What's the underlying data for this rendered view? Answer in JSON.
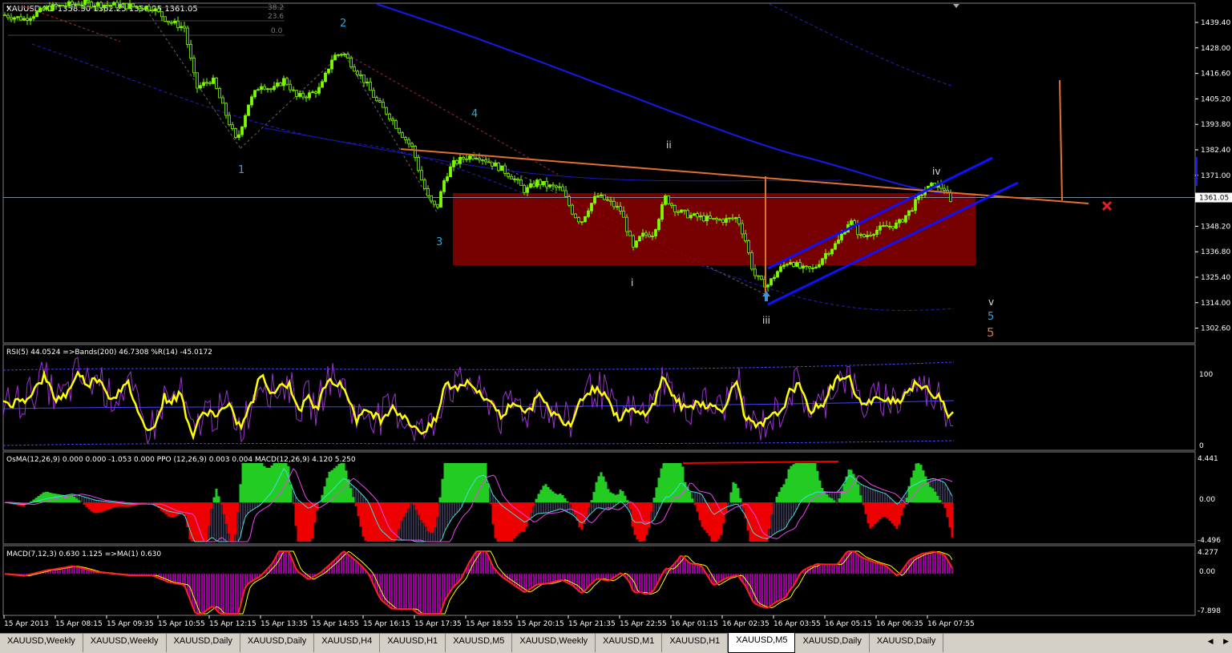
{
  "chart_data": {
    "type": "candlestick",
    "symbol_header": "XAUUSD,M5  1358.30 1362.25 1358.25 1361.05",
    "ylim": [
      1296.0,
      1448.0
    ],
    "y_ticks": [
      "1439.40",
      "1428.00",
      "1416.60",
      "1405.20",
      "1393.80",
      "1382.40",
      "1371.00",
      "1348.20",
      "1336.80",
      "1325.40",
      "1314.00",
      "1302.60"
    ],
    "current_price_label": "1361.05",
    "current_price": 1361.05,
    "x_ticks": [
      "15 Apr 2013",
      "15 Apr 08:15",
      "15 Apr 09:35",
      "15 Apr 10:55",
      "15 Apr 12:15",
      "15 Apr 13:35",
      "15 Apr 14:55",
      "15 Apr 16:15",
      "15 Apr 17:35",
      "15 Apr 18:55",
      "15 Apr 20:15",
      "15 Apr 21:35",
      "15 Apr 22:55",
      "16 Apr 01:15",
      "16 Apr 02:35",
      "16 Apr 03:55",
      "16 Apr 05:15",
      "16 Apr 06:35",
      "16 Apr 07:55"
    ],
    "fib_labels": [
      "38.2",
      "23.6",
      "0.0"
    ],
    "close_path": [
      [
        0,
        1443
      ],
      [
        30,
        1441
      ],
      [
        60,
        1446
      ],
      [
        100,
        1448
      ],
      [
        150,
        1447
      ],
      [
        190,
        1446
      ],
      [
        210,
        1440
      ],
      [
        230,
        1437
      ],
      [
        245,
        1410
      ],
      [
        265,
        1414
      ],
      [
        280,
        1400
      ],
      [
        295,
        1386
      ],
      [
        310,
        1403
      ],
      [
        325,
        1412
      ],
      [
        340,
        1409
      ],
      [
        355,
        1414
      ],
      [
        370,
        1406
      ],
      [
        385,
        1407
      ],
      [
        400,
        1410
      ],
      [
        415,
        1424
      ],
      [
        428,
        1426
      ],
      [
        440,
        1420
      ],
      [
        455,
        1413
      ],
      [
        470,
        1404
      ],
      [
        485,
        1398
      ],
      [
        500,
        1390
      ],
      [
        515,
        1383
      ],
      [
        525,
        1370
      ],
      [
        535,
        1360
      ],
      [
        545,
        1356
      ],
      [
        555,
        1370
      ],
      [
        565,
        1376
      ],
      [
        580,
        1379
      ],
      [
        595,
        1380
      ],
      [
        610,
        1377
      ],
      [
        625,
        1374
      ],
      [
        640,
        1370
      ],
      [
        655,
        1364
      ],
      [
        670,
        1368
      ],
      [
        685,
        1366
      ],
      [
        700,
        1365
      ],
      [
        715,
        1354
      ],
      [
        725,
        1350
      ],
      [
        735,
        1357
      ],
      [
        745,
        1362
      ],
      [
        760,
        1359
      ],
      [
        775,
        1355
      ],
      [
        790,
        1338
      ],
      [
        800,
        1344
      ],
      [
        815,
        1345
      ],
      [
        830,
        1361
      ],
      [
        845,
        1355
      ],
      [
        860,
        1353
      ],
      [
        875,
        1352
      ],
      [
        890,
        1351
      ],
      [
        905,
        1351
      ],
      [
        920,
        1352
      ],
      [
        930,
        1342
      ],
      [
        940,
        1327
      ],
      [
        950,
        1323
      ],
      [
        958,
        1322
      ],
      [
        970,
        1328
      ],
      [
        985,
        1333
      ],
      [
        1000,
        1329
      ],
      [
        1015,
        1329
      ],
      [
        1030,
        1336
      ],
      [
        1045,
        1341
      ],
      [
        1060,
        1351
      ],
      [
        1075,
        1343
      ],
      [
        1090,
        1346
      ],
      [
        1105,
        1348
      ],
      [
        1120,
        1349
      ],
      [
        1135,
        1355
      ],
      [
        1150,
        1363
      ],
      [
        1165,
        1367
      ],
      [
        1178,
        1365
      ],
      [
        1188,
        1357
      ]
    ],
    "wave_labels": [
      {
        "text": "1",
        "price": 1384
      },
      {
        "text": "2",
        "price": 1443
      },
      {
        "text": "3",
        "price": 1343
      },
      {
        "text": "4",
        "price": 1398
      },
      {
        "text": "ii",
        "price": 1381
      },
      {
        "text": "i",
        "price": 1328
      },
      {
        "text": "iii",
        "price": 1306
      },
      {
        "text": "iv",
        "price": 1374
      },
      {
        "text": "v",
        "price": 1318
      },
      {
        "text": "5",
        "price": 1313
      },
      {
        "text": "5",
        "price": 1305
      }
    ],
    "rsi": {
      "header": "RSI(5) 44.0524  =>Bands(200) 46.7308  %R(14) -45.0172",
      "ylim": [
        0,
        100
      ],
      "y_ticks": [
        "100",
        "0"
      ],
      "path": [
        [
          0,
          50
        ],
        [
          15,
          48
        ],
        [
          30,
          52
        ],
        [
          45,
          65
        ],
        [
          55,
          78
        ],
        [
          70,
          52
        ],
        [
          85,
          60
        ],
        [
          95,
          82
        ],
        [
          110,
          70
        ],
        [
          125,
          78
        ],
        [
          135,
          55
        ],
        [
          150,
          60
        ],
        [
          160,
          70
        ],
        [
          170,
          45
        ],
        [
          180,
          20
        ],
        [
          195,
          25
        ],
        [
          205,
          55
        ],
        [
          215,
          50
        ],
        [
          225,
          60
        ],
        [
          240,
          10
        ],
        [
          255,
          40
        ],
        [
          270,
          35
        ],
        [
          285,
          45
        ],
        [
          300,
          20
        ],
        [
          315,
          50
        ],
        [
          325,
          80
        ],
        [
          340,
          60
        ],
        [
          350,
          68
        ],
        [
          360,
          70
        ],
        [
          375,
          40
        ],
        [
          385,
          55
        ],
        [
          395,
          40
        ],
        [
          410,
          80
        ],
        [
          420,
          70
        ],
        [
          430,
          65
        ],
        [
          445,
          30
        ],
        [
          460,
          40
        ],
        [
          475,
          30
        ],
        [
          490,
          45
        ],
        [
          505,
          30
        ],
        [
          520,
          20
        ],
        [
          530,
          15
        ],
        [
          545,
          30
        ],
        [
          555,
          70
        ],
        [
          570,
          65
        ],
        [
          585,
          75
        ],
        [
          600,
          55
        ],
        [
          615,
          50
        ],
        [
          625,
          30
        ],
        [
          635,
          45
        ],
        [
          645,
          50
        ],
        [
          660,
          35
        ],
        [
          670,
          60
        ],
        [
          685,
          40
        ],
        [
          700,
          30
        ],
        [
          712,
          25
        ],
        [
          725,
          55
        ],
        [
          740,
          65
        ],
        [
          755,
          60
        ],
        [
          770,
          30
        ],
        [
          785,
          40
        ],
        [
          800,
          35
        ],
        [
          815,
          45
        ],
        [
          828,
          80
        ],
        [
          840,
          55
        ],
        [
          855,
          40
        ],
        [
          870,
          50
        ],
        [
          885,
          45
        ],
        [
          900,
          40
        ],
        [
          912,
          60
        ],
        [
          920,
          75
        ],
        [
          930,
          30
        ],
        [
          945,
          20
        ],
        [
          960,
          30
        ],
        [
          975,
          40
        ],
        [
          985,
          60
        ],
        [
          995,
          70
        ],
        [
          1010,
          40
        ],
        [
          1025,
          45
        ],
        [
          1040,
          70
        ],
        [
          1050,
          80
        ],
        [
          1060,
          75
        ],
        [
          1075,
          45
        ],
        [
          1090,
          50
        ],
        [
          1105,
          55
        ],
        [
          1120,
          50
        ],
        [
          1135,
          65
        ],
        [
          1145,
          70
        ],
        [
          1160,
          60
        ],
        [
          1175,
          55
        ],
        [
          1185,
          30
        ],
        [
          1190,
          45
        ]
      ]
    },
    "osma": {
      "header": "OsMA(12,26,9) 0.000 0.000 -1.053 0.000  PPO (12,26,9) 0.003 0.004  MACD(12,26,9) 4.120 5.250",
      "ylim": [
        -5.2,
        5.2
      ],
      "y_ticks": [
        "4.441",
        "0.00",
        "-4.496"
      ]
    },
    "macd2": {
      "header": "MACD(7,12,3) 0.630 1.125  =>MA(1) 0.630",
      "ylim": [
        -8.5,
        4.8
      ],
      "y_ticks": [
        "4.277",
        "0.00",
        "-7.898"
      ]
    }
  },
  "tabs": [
    {
      "label": "XAUUSD,Weekly",
      "active": false
    },
    {
      "label": "XAUUSD,Weekly",
      "active": false
    },
    {
      "label": "XAUUSD,Daily",
      "active": false
    },
    {
      "label": "XAUUSD,Daily",
      "active": false
    },
    {
      "label": "XAUUSD,H4",
      "active": false
    },
    {
      "label": "XAUUSD,H1",
      "active": false
    },
    {
      "label": "XAUUSD,M5",
      "active": false
    },
    {
      "label": "XAUUSD,Weekly",
      "active": false
    },
    {
      "label": "XAUUSD,M1",
      "active": false
    },
    {
      "label": "XAUUSD,H1",
      "active": false
    },
    {
      "label": "XAUUSD,M5",
      "active": true
    },
    {
      "label": "XAUUSD,Daily",
      "active": false
    },
    {
      "label": "XAUUSD,Daily",
      "active": false
    }
  ],
  "colors": {
    "bull": "#7cfc00",
    "bear": "#7cfc00",
    "ma_blue": "#1010e0",
    "box": "#8b0000",
    "trend": "#e07030",
    "rsi": "#ffff00",
    "hist_up": "#22cc22",
    "hist_dn": "#ee0000",
    "hist_purple": "#990099"
  }
}
